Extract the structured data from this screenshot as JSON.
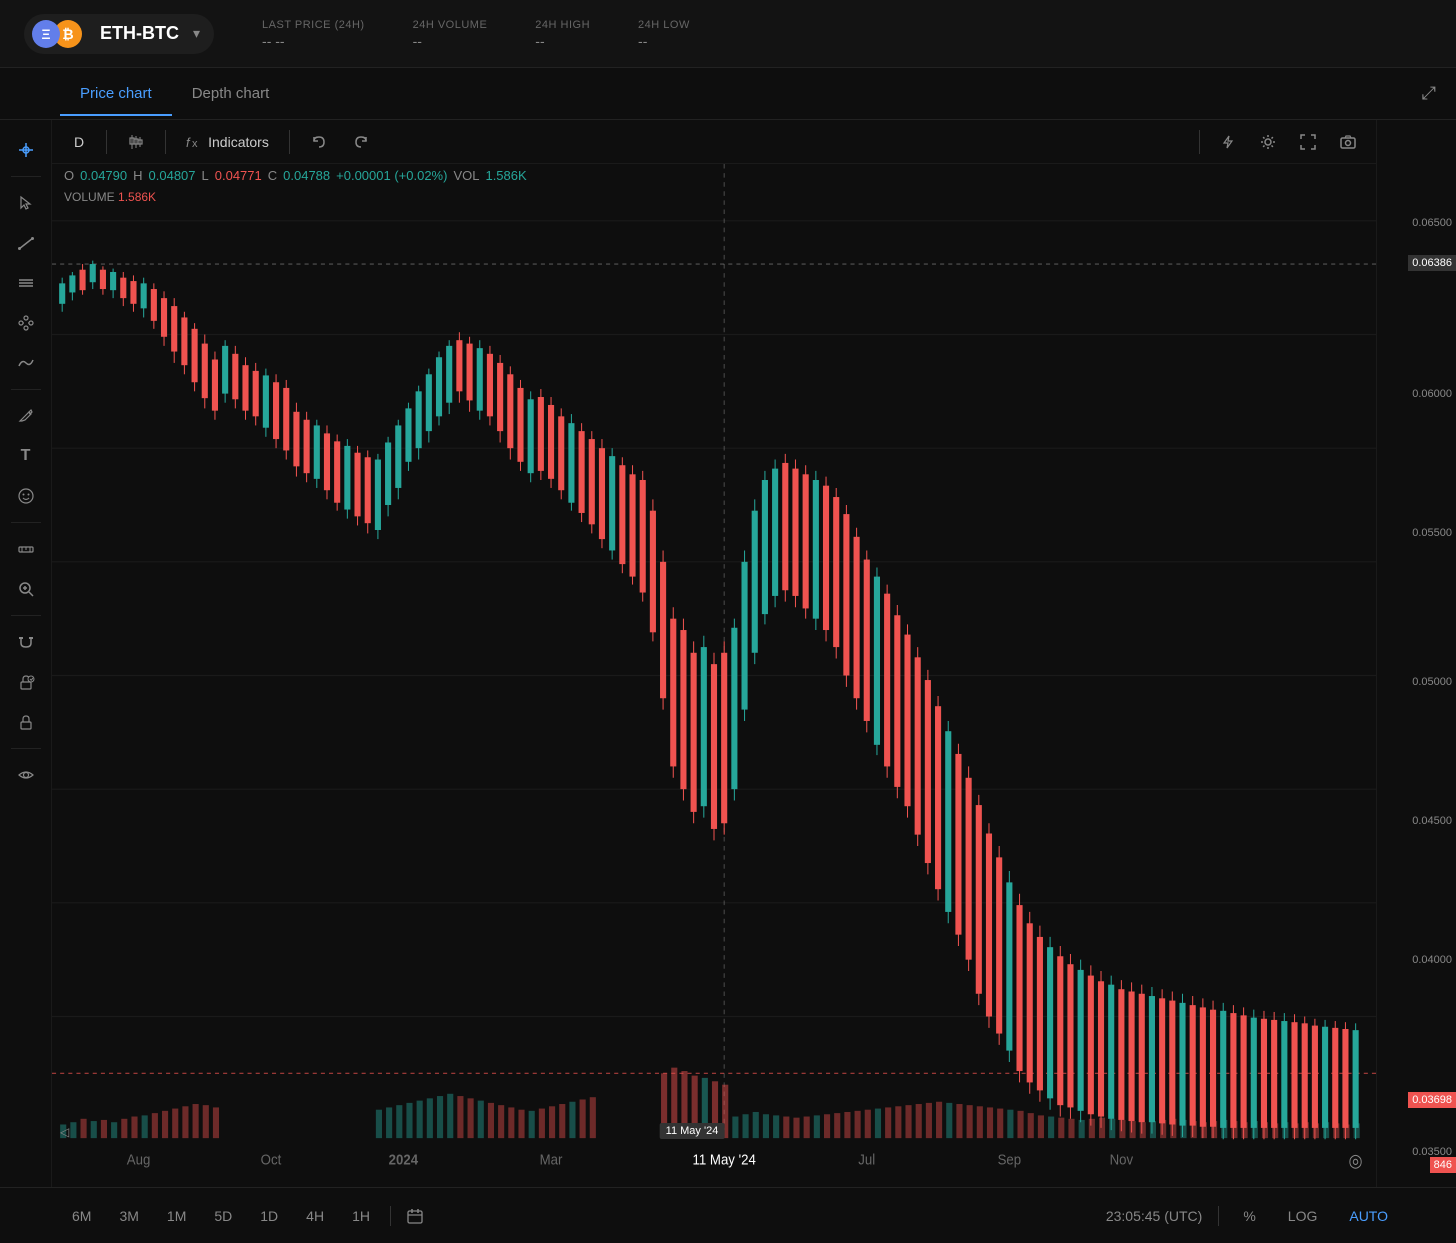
{
  "header": {
    "pair": "ETH-BTC",
    "eth_symbol": "Ξ",
    "btc_symbol": "₿",
    "stats": {
      "last_price_label": "LAST PRICE (24H)",
      "last_price_value": "-- --",
      "volume_label": "24H VOLUME",
      "volume_value": "--",
      "high_label": "24H HIGH",
      "high_value": "--",
      "low_label": "24H LOW",
      "low_value": "--"
    }
  },
  "tabs": {
    "price_chart": "Price chart",
    "depth_chart": "Depth chart"
  },
  "chart_toolbar": {
    "timeframe": "D",
    "indicators_label": "Indicators",
    "undo_label": "↩",
    "redo_label": "↪"
  },
  "ohlc": {
    "o_label": "O",
    "o_value": "0.04790",
    "h_label": "H",
    "h_value": "0.04807",
    "l_label": "L",
    "l_value": "0.04771",
    "c_label": "C",
    "c_value": "0.04788",
    "change": "+0.00001 (+0.02%)",
    "vol_label": "VOL",
    "vol_value": "1.586K"
  },
  "volume_indicator": {
    "label": "VOLUME",
    "value": "1.586K"
  },
  "price_axis": {
    "levels": [
      "0.06500",
      "0.06386",
      "0.06000",
      "0.05500",
      "0.05000",
      "0.04500",
      "0.04000",
      "0.03698",
      "0.03500",
      "846"
    ]
  },
  "time_axis": {
    "labels": [
      "Aug",
      "Oct",
      "2024",
      "Mar",
      "11 May '24",
      "Jul",
      "Sep",
      "Nov"
    ]
  },
  "bottom_bar": {
    "timeframes": [
      "6M",
      "3M",
      "1M",
      "5D",
      "1D",
      "4H",
      "1H"
    ],
    "time_utc": "23:05:45 (UTC)",
    "percent_btn": "%",
    "log_btn": "LOG",
    "auto_btn": "AUTO"
  },
  "left_toolbar": {
    "icons": [
      {
        "name": "crosshair-icon",
        "symbol": "⊕"
      },
      {
        "name": "cursor-icon",
        "symbol": "↖"
      },
      {
        "name": "trend-line-icon",
        "symbol": "╱"
      },
      {
        "name": "horizontal-line-icon",
        "symbol": "≡"
      },
      {
        "name": "node-icon",
        "symbol": "⋮"
      },
      {
        "name": "path-icon",
        "symbol": "〰"
      },
      {
        "name": "pen-icon",
        "symbol": "✏"
      },
      {
        "name": "text-icon",
        "symbol": "T"
      },
      {
        "name": "shape-icon",
        "symbol": "◯"
      },
      {
        "name": "ruler-icon",
        "symbol": "📏"
      },
      {
        "name": "magnify-icon",
        "symbol": "🔍"
      },
      {
        "name": "magnet-icon",
        "symbol": "⊓"
      },
      {
        "name": "lock-pencil-icon",
        "symbol": "🖊"
      },
      {
        "name": "lock-icon",
        "symbol": "🔒"
      },
      {
        "name": "eye-icon",
        "symbol": "👁"
      }
    ]
  }
}
